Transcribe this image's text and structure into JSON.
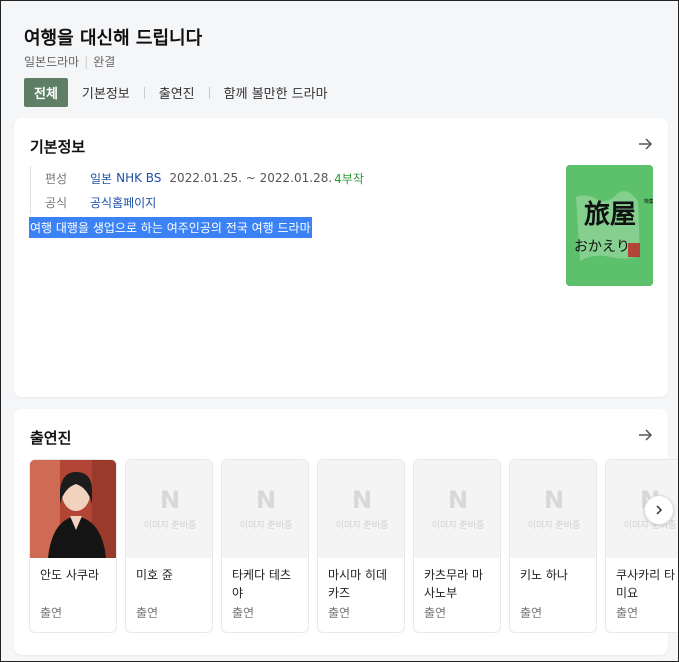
{
  "header": {
    "title": "여행을 대신해 드립니다",
    "meta": [
      "일본드라마",
      "완결"
    ],
    "tabs": [
      {
        "label": "전체",
        "active": true
      },
      {
        "label": "기본정보"
      },
      {
        "label": "출연진"
      },
      {
        "label": "함께 볼만한 드라마"
      }
    ]
  },
  "basic_info": {
    "title": "기본정보",
    "broadcast_key": "편성",
    "broadcast_country": "일본",
    "broadcast_channel": "NHK BS",
    "broadcast_period": "2022.01.25. ~ 2022.01.28.",
    "broadcast_episodes": "4부작",
    "official_key": "공식",
    "official_link": "공식홈페이지",
    "description": "여행 대행을 생업으로 하는 여주인공의 전국 여행 드라마",
    "poster_text": "旅屋おかえり",
    "poster_small_text": "特集ドラマ"
  },
  "cast_section": {
    "title": "출연진",
    "placeholder_logo": "N",
    "placeholder_label": "이미지 준비중",
    "members": [
      {
        "name": "안도 사쿠라",
        "role": "출연",
        "photo": true
      },
      {
        "name": "미호 쥰",
        "role": "출연",
        "photo": false
      },
      {
        "name": "타케다 테츠야",
        "role": "출연",
        "photo": false
      },
      {
        "name": "마시마 히데카즈",
        "role": "출연",
        "photo": false
      },
      {
        "name": "카츠무라 마사노부",
        "role": "출연",
        "photo": false
      },
      {
        "name": "키노 하나",
        "role": "출연",
        "photo": false
      },
      {
        "name": "쿠사카리 타미요",
        "role": "출연",
        "photo": false
      }
    ]
  },
  "colors": {
    "accent": "#5e7f66",
    "link": "#1e4fa6",
    "episodes": "#2b9a37",
    "selection": "#3b82f6",
    "poster": "#5dc06a"
  }
}
